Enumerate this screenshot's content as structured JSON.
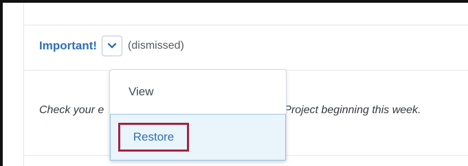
{
  "announcement": {
    "title": "Important!",
    "status": "(dismissed)",
    "body_prefix": "Check your e",
    "body_suffix": "Project beginning this week."
  },
  "menu": {
    "items": [
      {
        "label": "View"
      },
      {
        "label": "Restore"
      }
    ]
  },
  "icons": {
    "dropdown": "chevron-down-icon"
  },
  "colors": {
    "accent": "#2f6fb4",
    "highlight_outline": "#a3213f",
    "selected_bg": "#eaf4fb"
  }
}
